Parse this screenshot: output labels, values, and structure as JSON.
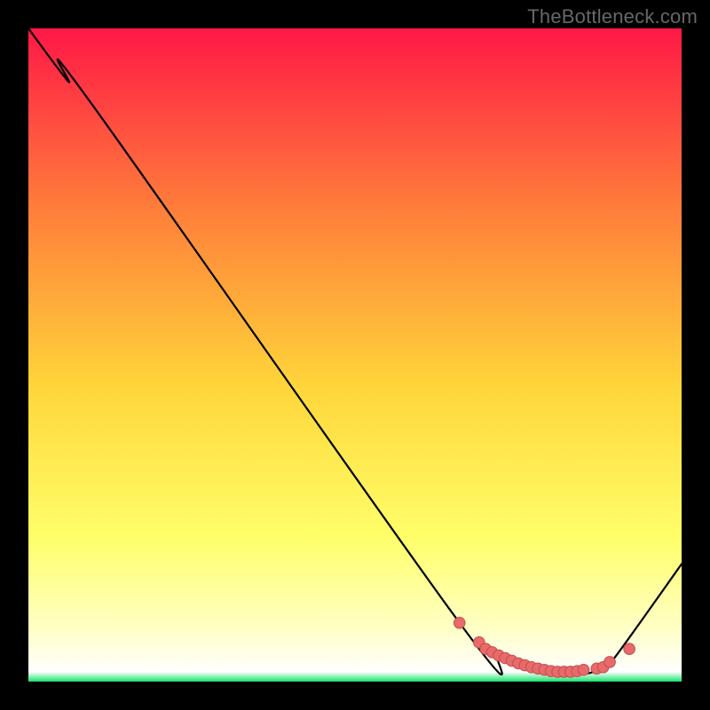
{
  "watermark": "TheBottleneck.com",
  "colors": {
    "gradient_top": "#ff1846",
    "gradient_mid_upper": "#ff7f3a",
    "gradient_mid": "#ffd63a",
    "gradient_mid_lower": "#ffff6a",
    "gradient_pale": "#ffffc6",
    "gradient_green": "#16e26b",
    "curve_stroke": "#000000",
    "marker_fill": "#e86a6a",
    "marker_stroke": "#c14e4e",
    "background": "#000000"
  },
  "chart_data": {
    "type": "line",
    "title": "",
    "xlabel": "",
    "ylabel": "",
    "xlim": [
      0,
      100
    ],
    "ylim": [
      0,
      100
    ],
    "series": [
      {
        "name": "curve",
        "x": [
          0,
          6,
          10,
          66,
          72,
          76,
          80,
          84,
          88,
          90,
          100
        ],
        "y": [
          100,
          92,
          88,
          9,
          4,
          2,
          1,
          1,
          2,
          4,
          18
        ]
      }
    ],
    "markers": {
      "name": "highlight-points",
      "x": [
        66,
        69,
        70,
        71,
        72,
        73,
        74,
        75,
        76,
        77,
        78,
        79,
        80,
        81,
        82,
        83,
        84,
        85,
        87,
        88,
        89,
        92
      ],
      "y": [
        9,
        6,
        5,
        4.5,
        4,
        3.6,
        3.2,
        2.8,
        2.5,
        2.2,
        2,
        1.8,
        1.6,
        1.5,
        1.5,
        1.5,
        1.6,
        1.8,
        2,
        2.2,
        3,
        5
      ]
    }
  }
}
